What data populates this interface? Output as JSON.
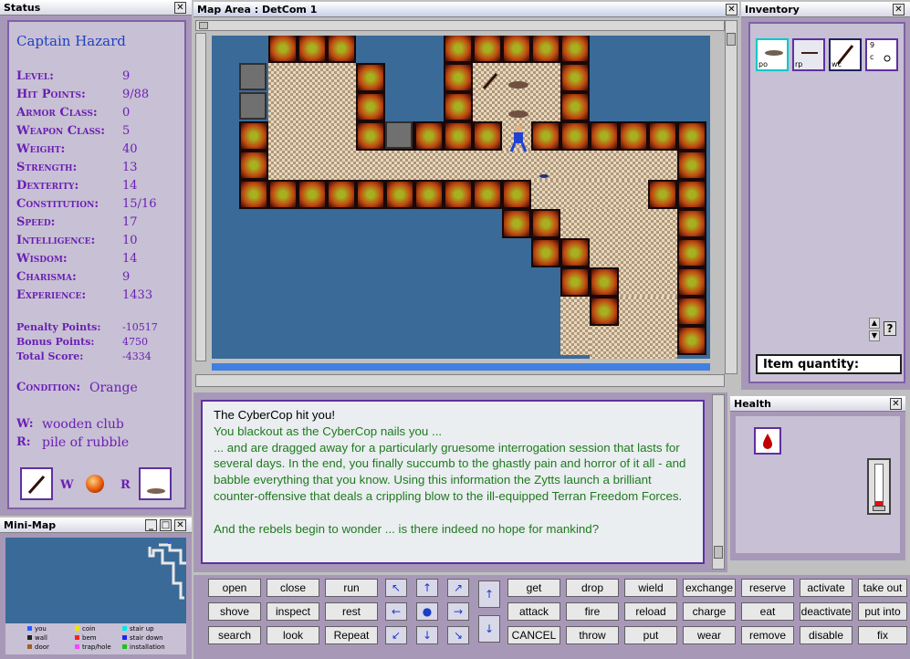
{
  "status": {
    "title": "Status",
    "name": "Captain Hazard",
    "stats": [
      {
        "label": "Level:",
        "value": "9"
      },
      {
        "label": "Hit Points:",
        "value": "9/88"
      },
      {
        "label": "Armor Class:",
        "value": "0"
      },
      {
        "label": "Weapon Class:",
        "value": "5"
      },
      {
        "label": "Weight:",
        "value": "40"
      },
      {
        "label": "Strength:",
        "value": "13"
      },
      {
        "label": "Dexterity:",
        "value": "14"
      },
      {
        "label": "Constitution:",
        "value": "15/16"
      },
      {
        "label": "Speed:",
        "value": "17"
      },
      {
        "label": "Intelligence:",
        "value": "10"
      },
      {
        "label": "Wisdom:",
        "value": "14"
      },
      {
        "label": "Charisma:",
        "value": "9"
      },
      {
        "label": "Experience:",
        "value": "1433"
      }
    ],
    "points": [
      {
        "label": "Penalty Points:",
        "value": "-10517"
      },
      {
        "label": "Bonus Points:",
        "value": "4750"
      },
      {
        "label": "Total Score:",
        "value": "-4334"
      }
    ],
    "condition_label": "Condition:",
    "condition_value": "Orange",
    "weapon_key": "W:",
    "weapon_value": "wooden club",
    "ready_key": "R:",
    "ready_value": "pile of rubble",
    "slot_w": "W",
    "slot_r": "R"
  },
  "minimap": {
    "title": "Mini-Map",
    "legend": [
      {
        "label": "you",
        "color": "#2060ff"
      },
      {
        "label": "coin",
        "color": "#e8e800"
      },
      {
        "label": "stair up",
        "color": "#00e8e8"
      },
      {
        "label": "wall",
        "color": "#202020"
      },
      {
        "label": "bem",
        "color": "#ff2020"
      },
      {
        "label": "stair down",
        "color": "#2020ff"
      },
      {
        "label": "door",
        "color": "#a06020"
      },
      {
        "label": "trap/hole",
        "color": "#ff40ff"
      },
      {
        "label": "installation",
        "color": "#20c020"
      }
    ]
  },
  "map": {
    "title": "Map Area : DetCom 1"
  },
  "inventory": {
    "title": "Inventory",
    "slots": [
      {
        "label": "po"
      },
      {
        "label": "rp"
      },
      {
        "label": "wc"
      },
      {
        "label": "c"
      }
    ],
    "slot_count": "9",
    "help": "?",
    "quantity_label": "Item quantity:"
  },
  "messages": [
    "The CyberCop hit you!",
    "You blackout as the CyberCop nails you ...",
    "... and are dragged away for a particularly gruesome interrogation session that lasts for several days.  In the end, you finally succumb to the ghastly pain and horror of it all - and babble everything that you know.  Using this information the Zytts launch a brilliant counter-offensive that deals a crippling blow to the ill-equipped Terran Freedom Forces.",
    "",
    "And the rebels begin to wonder ... is there indeed no hope for mankind?"
  ],
  "health": {
    "title": "Health",
    "level": 0.1
  },
  "commands": {
    "col1": [
      "open",
      "shove",
      "search"
    ],
    "col2": [
      "close",
      "inspect",
      "look"
    ],
    "col3": [
      "run",
      "rest",
      "Repeat"
    ],
    "col4": [
      "get",
      "attack",
      "CANCEL"
    ],
    "col5": [
      "drop",
      "fire",
      "throw"
    ],
    "col6": [
      "wield",
      "reload",
      "put"
    ],
    "col7": [
      "exchange",
      "charge",
      "wear"
    ],
    "col8": [
      "reserve",
      "eat",
      "remove"
    ],
    "col9": [
      "activate",
      "deactivate",
      "disable"
    ],
    "col10": [
      "take out",
      "put into",
      "fix"
    ],
    "arrows": [
      "↖",
      "↑",
      "↗",
      "←",
      "●",
      "→",
      "↙",
      "↓",
      "↘"
    ],
    "stair_up": "↑",
    "stair_down": "↓"
  },
  "colors": {
    "status_text": "#6a1fb4",
    "message_text": "#1f7a1f",
    "map_water": "#3a6a98"
  }
}
